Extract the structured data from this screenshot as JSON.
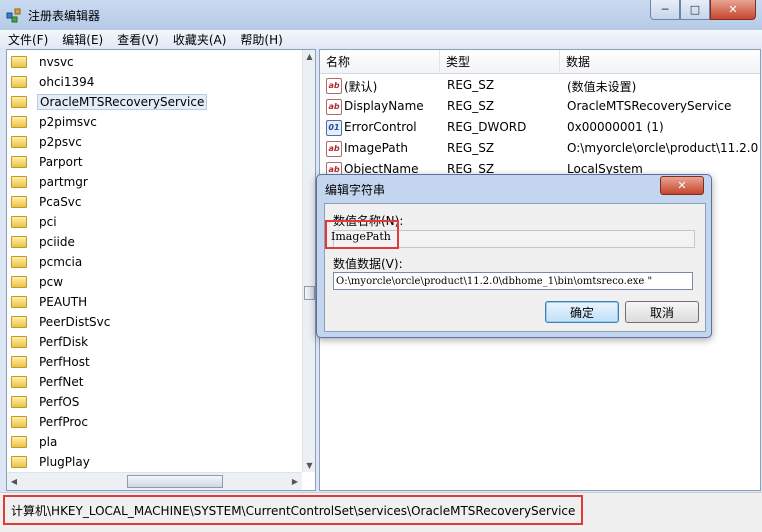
{
  "window": {
    "title": "注册表编辑器",
    "minimize": "─",
    "maximize": "□",
    "close": "✕"
  },
  "menu": [
    "文件(F)",
    "编辑(E)",
    "查看(V)",
    "收藏夹(A)",
    "帮助(H)"
  ],
  "tree": {
    "items": [
      "nvsvc",
      "ohci1394",
      "OracleMTSRecoveryService",
      "p2pimsvc",
      "p2psvc",
      "Parport",
      "partmgr",
      "PcaSvc",
      "pci",
      "pciide",
      "pcmcia",
      "pcw",
      "PEAUTH",
      "PeerDistSvc",
      "PerfDisk",
      "PerfHost",
      "PerfNet",
      "PerfOS",
      "PerfProc",
      "pla",
      "PlugPlay"
    ],
    "selected": "OracleMTSRecoveryService"
  },
  "list": {
    "columns": [
      "名称",
      "类型",
      "数据"
    ],
    "rows": [
      {
        "icon": "string-value-icon",
        "name": "(默认)",
        "type": "REG_SZ",
        "data": "(数值未设置)"
      },
      {
        "icon": "string-value-icon",
        "name": "DisplayName",
        "type": "REG_SZ",
        "data": "OracleMTSRecoveryService"
      },
      {
        "icon": "dword-value-icon",
        "name": "ErrorControl",
        "type": "REG_DWORD",
        "data": "0x00000001 (1)"
      },
      {
        "icon": "string-value-icon",
        "name": "ImagePath",
        "type": "REG_SZ",
        "data": "O:\\myorcle\\orcle\\product\\11.2.0"
      },
      {
        "icon": "string-value-icon",
        "name": "ObjectName",
        "type": "REG_SZ",
        "data": "LocalSystem"
      }
    ]
  },
  "dialog": {
    "title": "编辑字符串",
    "close": "✕",
    "name_label": "数值名称(N):",
    "name_value": "ImagePath",
    "data_label": "数值数据(V):",
    "data_value": "O:\\myorcle\\orcle\\product\\11.2.0\\dbhome_1\\bin\\omtsreco.exe \"",
    "ok": "确定",
    "cancel": "取消"
  },
  "status": {
    "path": "计算机\\HKEY_LOCAL_MACHINE\\SYSTEM\\CurrentControlSet\\services\\OracleMTSRecoveryService"
  },
  "colors": {
    "highlight_border": "#e13a3a",
    "selection": "#e3ecf8"
  }
}
